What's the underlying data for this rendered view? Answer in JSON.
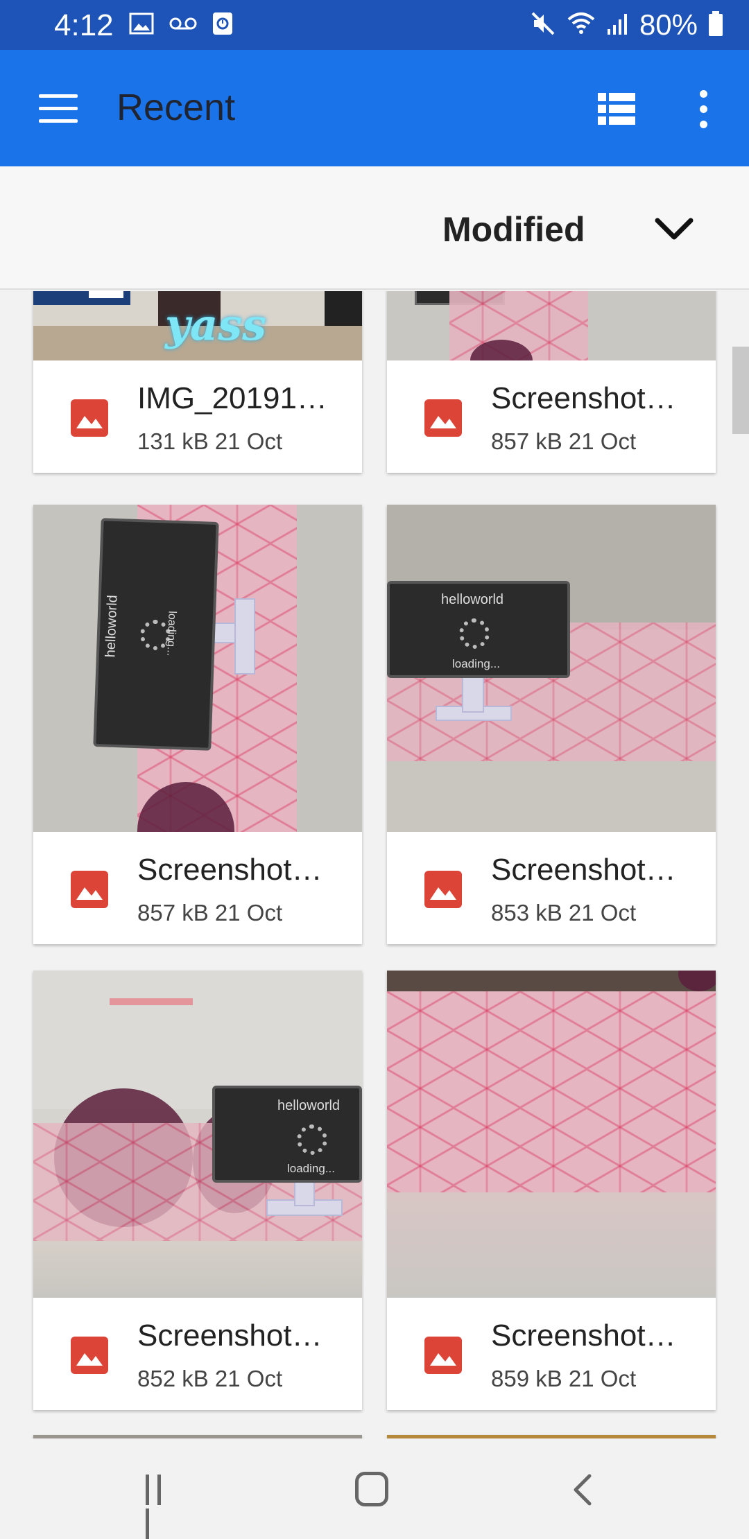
{
  "status_bar": {
    "time": "4:12",
    "battery": "80%",
    "left_icons": [
      "image-icon",
      "voicemail-icon",
      "screen-recorder-icon"
    ],
    "right_icons": [
      "mute-icon",
      "wifi-icon",
      "signal-icon",
      "battery-icon"
    ]
  },
  "app_bar": {
    "title": "Recent",
    "menu_icon": "hamburger-menu-icon",
    "view_icon": "list-view-icon",
    "more_icon": "more-vert-icon",
    "background": "#1a73e8"
  },
  "sort": {
    "label": "Modified",
    "icon": "chevron-down-icon"
  },
  "files": [
    {
      "name": "IMG_20191…",
      "size": "131 kB",
      "date": "21 Oct",
      "icon": "image-file-icon"
    },
    {
      "name": "Screenshot…",
      "size": "857 kB",
      "date": "21 Oct",
      "icon": "image-file-icon"
    },
    {
      "name": "Screenshot…",
      "size": "857 kB",
      "date": "21 Oct",
      "icon": "image-file-icon"
    },
    {
      "name": "Screenshot…",
      "size": "853 kB",
      "date": "21 Oct",
      "icon": "image-file-icon"
    },
    {
      "name": "Screenshot…",
      "size": "852 kB",
      "date": "21 Oct",
      "icon": "image-file-icon"
    },
    {
      "name": "Screenshot…",
      "size": "859 kB",
      "date": "21 Oct",
      "icon": "image-file-icon"
    }
  ],
  "thumbnail_text": {
    "sticker": "yass",
    "monitor_title": "helloworld",
    "monitor_status": "loading..."
  },
  "nav_bar": {
    "recent_apps_icon": "recent-apps-icon",
    "home_icon": "home-icon",
    "back_icon": "back-icon"
  },
  "colors": {
    "file_icon_red": "#db4437",
    "status_bar": "#1e54b7"
  }
}
